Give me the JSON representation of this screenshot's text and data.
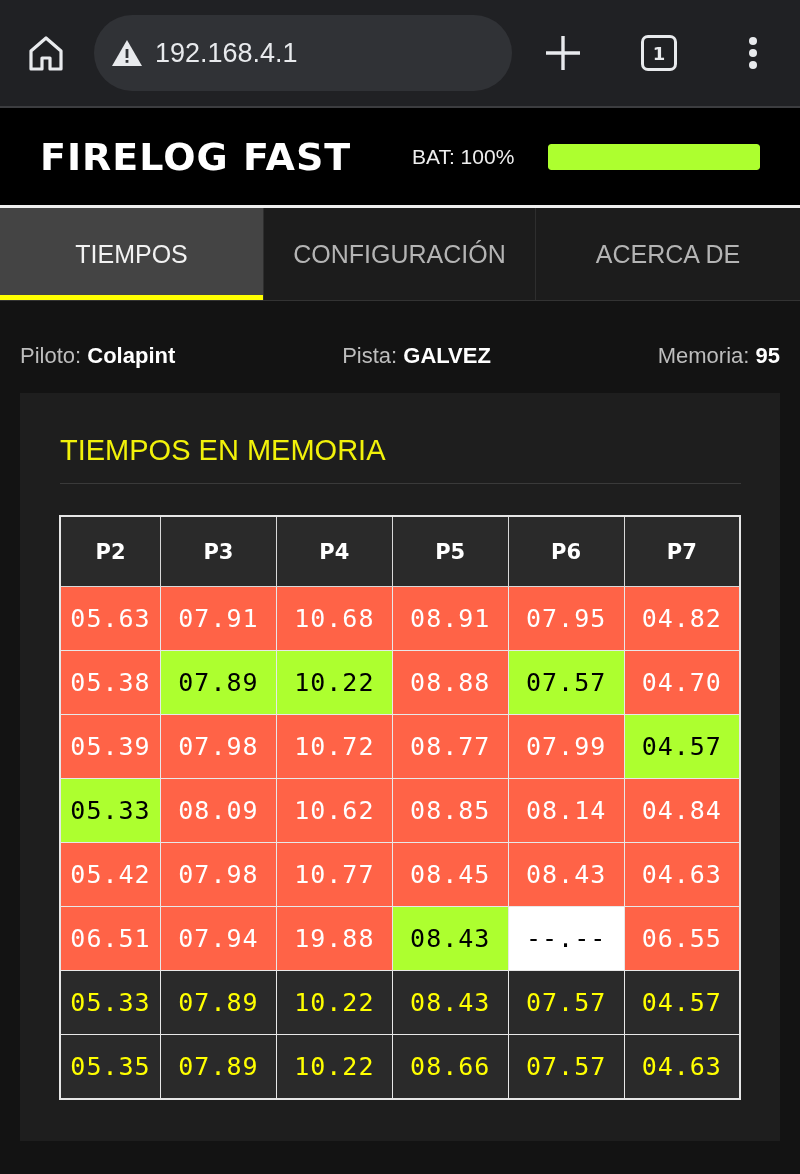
{
  "browser": {
    "url": "192.168.4.1",
    "tab_count": "1"
  },
  "header": {
    "title": "FIRELOG FAST",
    "battery": {
      "label": "BAT: 100%",
      "level": 1
    }
  },
  "tabs": [
    {
      "label": "TIEMPOS",
      "selected": true
    },
    {
      "label": "CONFIGURACIÓN",
      "selected": false
    },
    {
      "label": "ACERCA DE",
      "selected": false
    }
  ],
  "info": [
    "Piloto: **Colapint**",
    "Pista: **GALVEZ**",
    "Memoria: **95**"
  ],
  "card": {
    "title": "TIEMPOS EN MEMORIA",
    "table": {
      "columns": [
        "P2",
        "P3",
        "P4",
        "P5",
        "P6",
        "P7"
      ],
      "rows": [
        [
          {
            "text": "05.63",
            "kind": "time"
          },
          {
            "text": "07.91",
            "kind": "time"
          },
          {
            "text": "10.68",
            "kind": "time"
          },
          {
            "text": "08.91",
            "kind": "time"
          },
          {
            "text": "07.95",
            "kind": "time"
          },
          {
            "text": "04.82",
            "kind": "time"
          }
        ],
        [
          {
            "text": "05.38",
            "kind": "time"
          },
          {
            "text": "07.89",
            "kind": "best"
          },
          {
            "text": "10.22",
            "kind": "best"
          },
          {
            "text": "08.88",
            "kind": "time"
          },
          {
            "text": "07.57",
            "kind": "best"
          },
          {
            "text": "04.70",
            "kind": "time"
          }
        ],
        [
          {
            "text": "05.39",
            "kind": "time"
          },
          {
            "text": "07.98",
            "kind": "time"
          },
          {
            "text": "10.72",
            "kind": "time"
          },
          {
            "text": "08.77",
            "kind": "time"
          },
          {
            "text": "07.99",
            "kind": "time"
          },
          {
            "text": "04.57",
            "kind": "best"
          }
        ],
        [
          {
            "text": "05.33",
            "kind": "best"
          },
          {
            "text": "08.09",
            "kind": "time"
          },
          {
            "text": "10.62",
            "kind": "time"
          },
          {
            "text": "08.85",
            "kind": "time"
          },
          {
            "text": "08.14",
            "kind": "time"
          },
          {
            "text": "04.84",
            "kind": "time"
          }
        ],
        [
          {
            "text": "05.42",
            "kind": "time"
          },
          {
            "text": "07.98",
            "kind": "time"
          },
          {
            "text": "10.77",
            "kind": "time"
          },
          {
            "text": "08.45",
            "kind": "time"
          },
          {
            "text": "08.43",
            "kind": "time"
          },
          {
            "text": "04.63",
            "kind": "time"
          }
        ],
        [
          {
            "text": "06.51",
            "kind": "time"
          },
          {
            "text": "07.94",
            "kind": "time"
          },
          {
            "text": "19.88",
            "kind": "time"
          },
          {
            "text": "08.43",
            "kind": "best"
          },
          {
            "text": "--.--",
            "kind": "blank"
          },
          {
            "text": "06.55",
            "kind": "time"
          }
        ],
        [
          {
            "text": "05.33",
            "kind": "summary"
          },
          {
            "text": "07.89",
            "kind": "summary"
          },
          {
            "text": "10.22",
            "kind": "summary"
          },
          {
            "text": "08.43",
            "kind": "summary"
          },
          {
            "text": "07.57",
            "kind": "summary"
          },
          {
            "text": "04.57",
            "kind": "summary"
          }
        ],
        [
          {
            "text": "05.35",
            "kind": "summary"
          },
          {
            "text": "07.89",
            "kind": "summary"
          },
          {
            "text": "10.22",
            "kind": "summary"
          },
          {
            "text": "08.66",
            "kind": "summary"
          },
          {
            "text": "07.57",
            "kind": "summary"
          },
          {
            "text": "04.63",
            "kind": "summary"
          }
        ]
      ]
    }
  }
}
